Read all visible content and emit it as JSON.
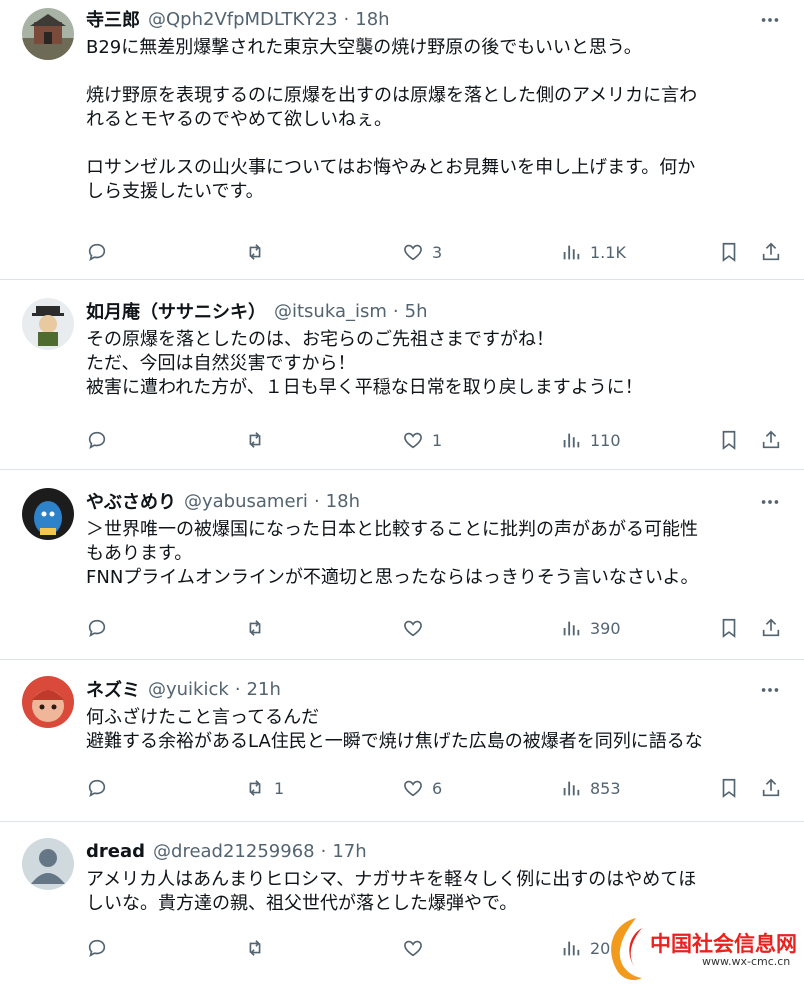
{
  "tweets": [
    {
      "name": "寺三郎",
      "handle": "@Qph2VfpMDLTKY23",
      "sep": "·",
      "time": "18h",
      "lines": [
        "B29に無差別爆撃された東京大空襲の焼け野原の後でもいいと思う。",
        "",
        "焼け野原を表現するのに原爆を出すのは原爆を落とした側のアメリカに言わ",
        "れるとモヤるのでやめて欲しいねぇ。",
        "",
        "ロサンゼルスの山火事についてはお悔やみとお見舞いを申し上げます。何か",
        "しら支援したいです。"
      ],
      "replies": "",
      "retweets": "",
      "likes": "3",
      "views": "1.1K"
    },
    {
      "name": "如月庵（ササニシキ）",
      "handle": "@itsuka_ism",
      "sep": "·",
      "time": "5h",
      "lines": [
        "その原爆を落としたのは、お宅らのご先祖さまですがね！",
        "ただ、今回は自然災害ですから！",
        "被害に遭われた方が、１日も早く平穏な日常を取り戻しますように！"
      ],
      "replies": "",
      "retweets": "",
      "likes": "1",
      "views": "110"
    },
    {
      "name": "やぶさめり",
      "handle": "@yabusameri",
      "sep": "·",
      "time": "18h",
      "lines": [
        "＞世界唯一の被爆国になった日本と比較することに批判の声があがる可能性",
        "もあります。",
        "FNNプライムオンラインが不適切と思ったならはっきりそう言いなさいよ。"
      ],
      "replies": "",
      "retweets": "",
      "likes": "",
      "views": "390"
    },
    {
      "name": "ネズミ",
      "handle": "@yuikick",
      "sep": "·",
      "time": "21h",
      "lines": [
        "何ふざけたこと言ってるんだ",
        "避難する余裕があるLA住民と一瞬で焼け焦げた広島の被爆者を同列に語るな"
      ],
      "replies": "",
      "retweets": "1",
      "likes": "6",
      "views": "853"
    },
    {
      "name": "dread",
      "handle": "@dread21259968",
      "sep": "·",
      "time": "17h",
      "lines": [
        "アメリカ人はあんまりヒロシマ、ナガサキを軽々しく例に出すのはやめてほ",
        "しいな。貴方達の親、祖父世代が落とした爆弾やで。"
      ],
      "replies": "",
      "retweets": "",
      "likes": "",
      "views": "20"
    }
  ],
  "watermark": {
    "text": "中国社会信息网",
    "url": "www.wx-cmc.cn"
  },
  "colors": {
    "text": "#0f1419",
    "muted": "#536471",
    "divider": "#dde2e6",
    "watermark": "#e8231f"
  },
  "icons": [
    "reply-icon",
    "retweet-icon",
    "like-icon",
    "views-icon",
    "bookmark-icon",
    "share-icon",
    "more-icon"
  ]
}
